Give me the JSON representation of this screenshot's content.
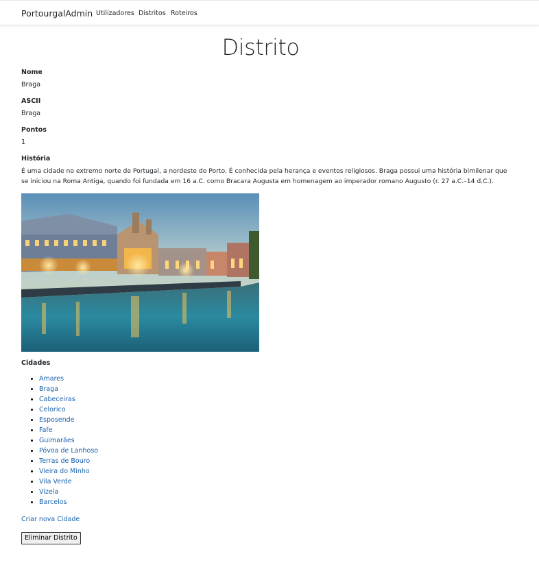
{
  "nav": {
    "brand": "PortourgalAdmin",
    "links": [
      "Utilizadores",
      "Distritos",
      "Roteiros"
    ]
  },
  "page": {
    "title": "Distrito"
  },
  "details": {
    "nome_label": "Nome",
    "nome_value": "Braga",
    "ascii_label": "ASCII",
    "ascii_value": "Braga",
    "pontos_label": "Pontos",
    "pontos_value": "1",
    "historia_label": "História",
    "historia_value": "É uma cidade no extremo norte de Portugal, a nordeste do Porto. É conhecida pela herança e eventos religiosos. Braga possui uma história bimilenar que se iniciou na Roma Antiga, quando foi fundada em 16 a.C. como Bracara Augusta em homenagem ao imperador romano Augusto (r. 27 a.C.–14 d.C.)."
  },
  "image": {
    "description": "photo"
  },
  "cidades": {
    "label": "Cidades",
    "items": [
      "Amares",
      "Braga",
      "Cabeceiras",
      "Celorico",
      "Esposende",
      "Fafe",
      "Guimarães",
      "Póvoa de Lanhoso",
      "Terras de Bouro",
      "Vieira do Minho",
      "Vila Verde",
      "Vizela",
      "Barcelos"
    ]
  },
  "actions": {
    "create_label": "Criar nova Cidade",
    "delete_label": "Eliminar Distrito"
  },
  "colors": {
    "link": "#1861ac",
    "text": "#212529"
  }
}
